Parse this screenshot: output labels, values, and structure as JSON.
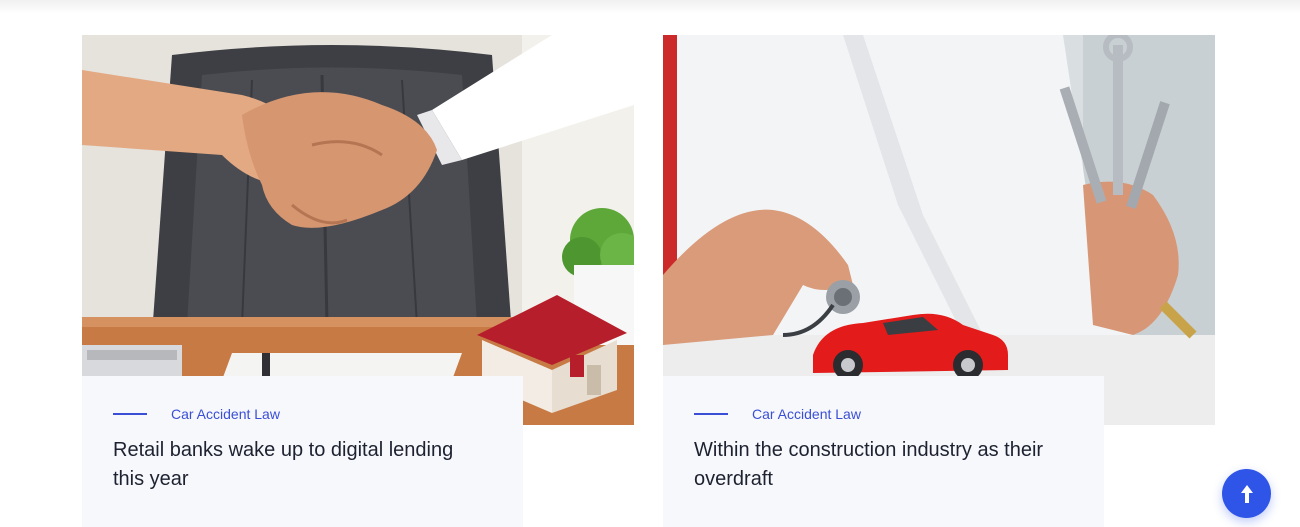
{
  "cards": [
    {
      "image_alt": "handshake with house model",
      "category": "Car Accident Law",
      "title": "Retail banks wake up to digital lending this year"
    },
    {
      "image_alt": "doctor with toy car and wrenches",
      "category": "Car Accident Law",
      "title": "Within the construction industry as their overdraft"
    }
  ],
  "scroll_top": {
    "icon": "arrow-up-icon"
  },
  "colors": {
    "accent": "#3a4fd6",
    "card_body_bg": "#f7f8fc",
    "title_text": "#1e2230",
    "scroll_button": "#2f55e8"
  }
}
